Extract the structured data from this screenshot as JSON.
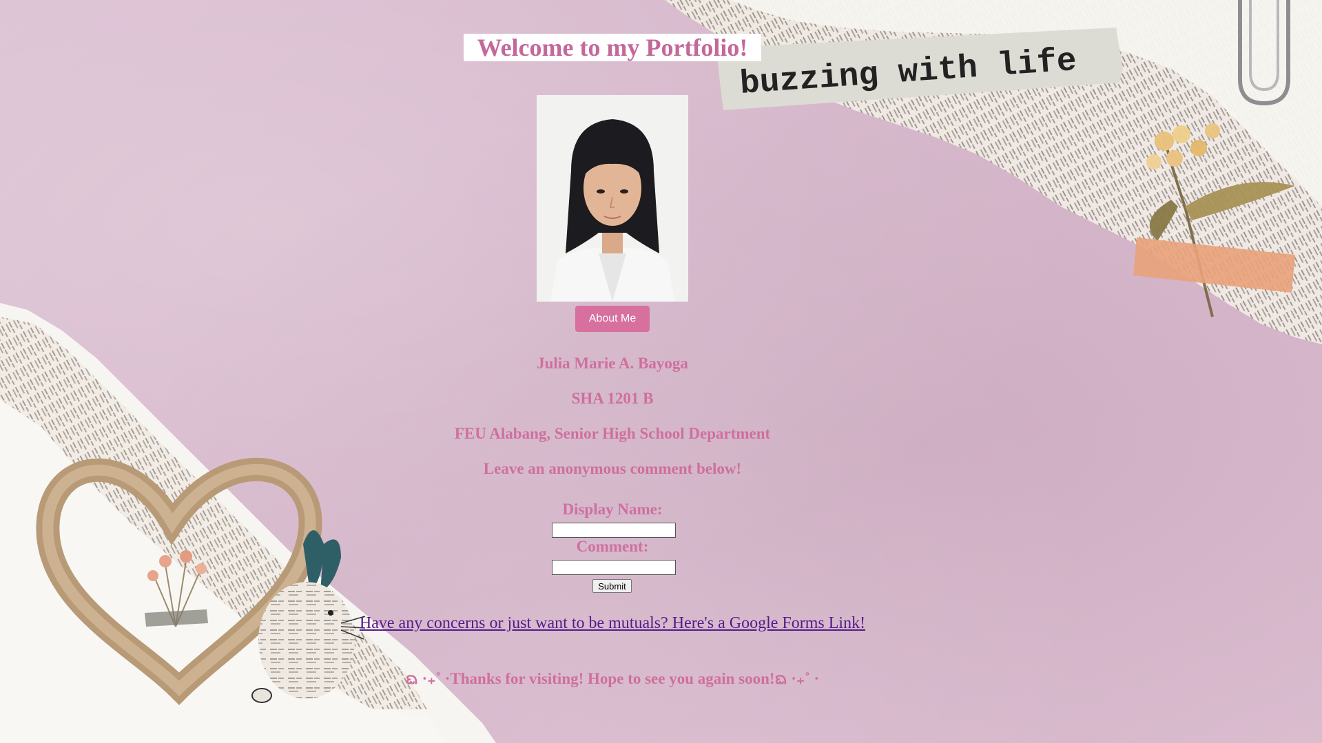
{
  "header": {
    "title": "Welcome to my Portfolio!"
  },
  "decorations": {
    "newspaper_strip_text": "buzzing with life"
  },
  "profile": {
    "photo_alt": "portrait photo",
    "about_button_label": "About Me",
    "name": "Julia Marie A. Bayoga",
    "section": "SHA 1201 B",
    "school": "FEU Alabang, Senior High School Department",
    "comment_prompt": "Leave an anonymous comment below!"
  },
  "comment_form": {
    "display_name_label": "Display Name:",
    "display_name_value": "",
    "comment_label": "Comment:",
    "comment_value": "",
    "submit_label": "Submit"
  },
  "links": {
    "google_forms_text": "Have any concerns or just want to be mutuals? Here's a Google Forms Link!"
  },
  "footer": {
    "thanks_text": "ᨳ ·₊˚ ·Thanks for visiting! Hope to see you again soon!ᨳ ·₊˚ ·"
  },
  "colors": {
    "background": "#d9bccf",
    "accent_pink": "#cf6f9d",
    "button_pink": "#d76f9f",
    "link_purple": "#551a8b"
  }
}
